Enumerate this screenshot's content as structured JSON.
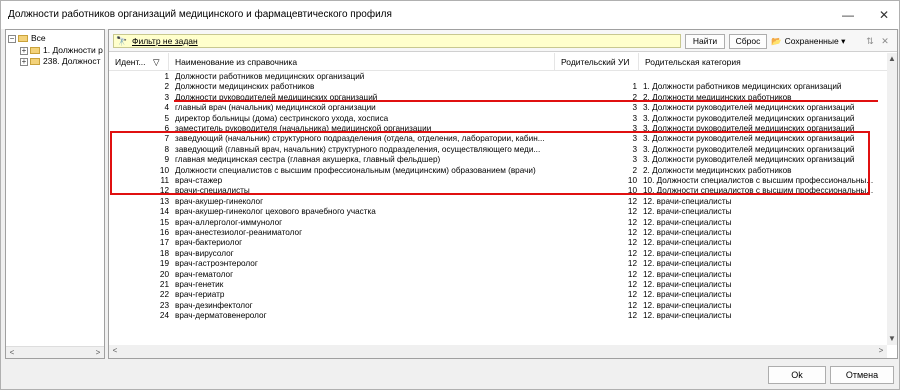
{
  "window": {
    "title": "Должности работников организаций медицинского и фармацевтического профиля",
    "min_symbol": "—",
    "close_symbol": "✕"
  },
  "tree": {
    "items": [
      {
        "toggle": "−",
        "label": "Все"
      },
      {
        "toggle": "+",
        "label": "1. Должности р"
      },
      {
        "toggle": "+",
        "label": "238. Должност"
      }
    ],
    "scroll_left": "<",
    "scroll_right": ">"
  },
  "toolbar": {
    "filter_icon": "binoculars-icon",
    "filter_glyph": "🔭",
    "filter_text": "Фильтр не задан",
    "find_label": "Найти",
    "reset_label": "Сброс",
    "saved_icon_glyph": "📂",
    "saved_label": "Сохраненные",
    "saved_dropdown": "▾",
    "icon_a_glyph": "⇅",
    "icon_b_glyph": "✕"
  },
  "grid": {
    "columns": {
      "id": "Идент...",
      "sort": "▽",
      "name": "Наименование из справочника",
      "parent": "Родительский УИ",
      "category": "Родительская категория"
    },
    "rows": [
      {
        "id": "1",
        "name": "Должности работников медицинских организаций",
        "parent": "",
        "category": ""
      },
      {
        "id": "2",
        "name": "Должности медицинских работников",
        "parent": "1",
        "category": "1. Должности работников медицинских организаций"
      },
      {
        "id": "3",
        "name": "Должности руководителей медицинских организаций",
        "parent": "2",
        "category": "2. Должности медицинских работников"
      },
      {
        "id": "4",
        "name": "главный врач (начальник) медицинской организации",
        "parent": "3",
        "category": "3. Должности руководителей медицинских организаций"
      },
      {
        "id": "5",
        "name": "директор больницы (дома) сестринского ухода, хосписа",
        "parent": "3",
        "category": "3. Должности руководителей медицинских организаций"
      },
      {
        "id": "6",
        "name": "заместитель руководителя (начальника) медицинской организации",
        "parent": "3",
        "category": "3. Должности руководителей медицинских организаций"
      },
      {
        "id": "7",
        "name": "заведующий (начальник) структурного подразделения (отдела, отделения, лаборатории, кабин...",
        "parent": "3",
        "category": "3. Должности руководителей медицинских организаций"
      },
      {
        "id": "8",
        "name": "заведующий (главный врач, начальник) структурного подразделения, осуществляющего меди...",
        "parent": "3",
        "category": "3. Должности руководителей медицинских организаций"
      },
      {
        "id": "9",
        "name": "главная медицинская сестра (главная акушерка, главный фельдшер)",
        "parent": "3",
        "category": "3. Должности руководителей медицинских организаций"
      },
      {
        "id": "10",
        "name": "Должности специалистов с высшим профессиональным (медицинским) образованием (врачи)",
        "parent": "2",
        "category": "2. Должности медицинских работников"
      },
      {
        "id": "11",
        "name": "врач-стажер",
        "parent": "10",
        "category": "10. Должности специалистов с высшим профессиональны..."
      },
      {
        "id": "12",
        "name": "врачи-специалисты",
        "parent": "10",
        "category": "10. Должности специалистов с высшим профессиональны..."
      },
      {
        "id": "13",
        "name": "врач-акушер-гинеколог",
        "parent": "12",
        "category": "12. врачи-специалисты"
      },
      {
        "id": "14",
        "name": "врач-акушер-гинеколог цехового врачебного участка",
        "parent": "12",
        "category": "12. врачи-специалисты"
      },
      {
        "id": "15",
        "name": "врач-аллерголог-иммунолог",
        "parent": "12",
        "category": "12. врачи-специалисты"
      },
      {
        "id": "16",
        "name": "врач-анестезиолог-реаниматолог",
        "parent": "12",
        "category": "12. врачи-специалисты"
      },
      {
        "id": "17",
        "name": "врач-бактериолог",
        "parent": "12",
        "category": "12. врачи-специалисты"
      },
      {
        "id": "18",
        "name": "врач-вирусолог",
        "parent": "12",
        "category": "12. врачи-специалисты"
      },
      {
        "id": "19",
        "name": "врач-гастроэнтеролог",
        "parent": "12",
        "category": "12. врачи-специалисты"
      },
      {
        "id": "20",
        "name": "врач-гематолог",
        "parent": "12",
        "category": "12. врачи-специалисты"
      },
      {
        "id": "21",
        "name": "врач-генетик",
        "parent": "12",
        "category": "12. врачи-специалисты"
      },
      {
        "id": "22",
        "name": "врач-гериатр",
        "parent": "12",
        "category": "12. врачи-специалисты"
      },
      {
        "id": "23",
        "name": "врач-дезинфектолог",
        "parent": "12",
        "category": "12. врачи-специалисты"
      },
      {
        "id": "24",
        "name": "врач-дерматовенеролог",
        "parent": "12",
        "category": "12. врачи-специалисты"
      }
    ],
    "scroll_up": "▲",
    "scroll_down": "▼",
    "scroll_left": "<",
    "scroll_right": ">"
  },
  "footer": {
    "ok_label": "Ok",
    "cancel_label": "Отмена"
  },
  "colors": {
    "highlight": "#e01010",
    "filter_bg": "#ffffcc"
  }
}
